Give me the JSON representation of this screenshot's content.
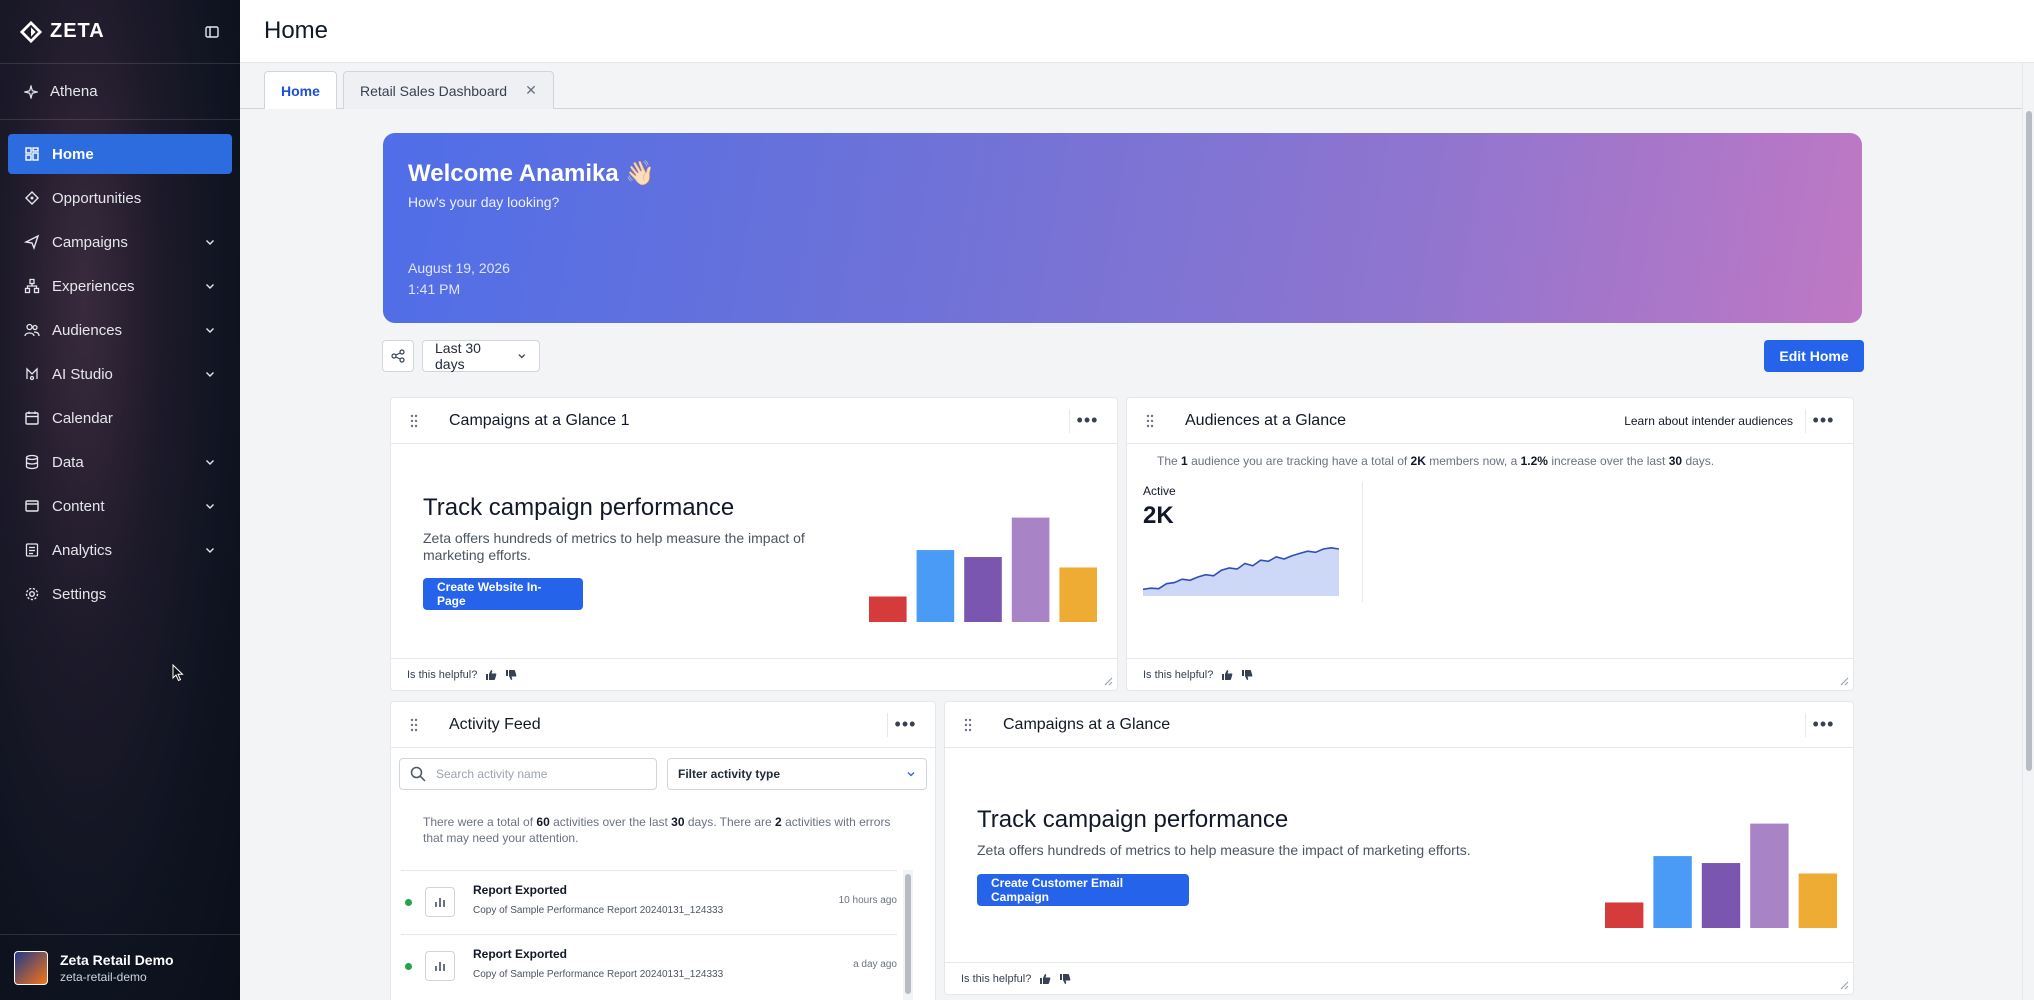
{
  "app": {
    "name": "ZETA"
  },
  "sidebar": {
    "athena_label": "Athena",
    "items": [
      {
        "label": "Home",
        "icon": "grid-icon",
        "active": true,
        "expandable": false
      },
      {
        "label": "Opportunities",
        "icon": "diamond-icon",
        "active": false,
        "expandable": false
      },
      {
        "label": "Campaigns",
        "icon": "send-icon",
        "active": false,
        "expandable": true
      },
      {
        "label": "Experiences",
        "icon": "flow-icon",
        "active": false,
        "expandable": true
      },
      {
        "label": "Audiences",
        "icon": "users-icon",
        "active": false,
        "expandable": true
      },
      {
        "label": "AI Studio",
        "icon": "ai-icon",
        "active": false,
        "expandable": true
      },
      {
        "label": "Calendar",
        "icon": "calendar-icon",
        "active": false,
        "expandable": false
      },
      {
        "label": "Data",
        "icon": "database-icon",
        "active": false,
        "expandable": true
      },
      {
        "label": "Content",
        "icon": "content-icon",
        "active": false,
        "expandable": true
      },
      {
        "label": "Analytics",
        "icon": "analytics-icon",
        "active": false,
        "expandable": true
      },
      {
        "label": "Settings",
        "icon": "gear-icon",
        "active": false,
        "expandable": false
      }
    ],
    "org": {
      "name": "Zeta Retail Demo",
      "id": "zeta-retail-demo"
    }
  },
  "header": {
    "title": "Home"
  },
  "tabs": [
    {
      "label": "Home",
      "active": true,
      "closable": false
    },
    {
      "label": "Retail Sales Dashboard",
      "active": false,
      "closable": true
    }
  ],
  "hero": {
    "title": "Welcome Anamika 👋🏻",
    "subtitle": "How's your day looking?",
    "date": "August 19, 2026",
    "time": "1:41 PM"
  },
  "toolbar": {
    "range": "Last 30 days",
    "edit_label": "Edit Home"
  },
  "cards": {
    "campaigns1": {
      "title": "Campaigns at a Glance 1",
      "promo_title": "Track campaign performance",
      "promo_desc": "Zeta offers hundreds of metrics to help measure the impact of marketing efforts.",
      "button": "Create Website In-Page",
      "helpful": "Is this helpful?"
    },
    "audiences": {
      "title": "Audiences at a Glance",
      "learn_link": "Learn about intender audiences",
      "summary": {
        "prefix": "The",
        "count": "1",
        "mid1": "audience you are tracking have a total of",
        "members": "2K",
        "mid2": "members now, a",
        "pct": "1.2%",
        "mid3": "increase over the last",
        "days": "30",
        "suffix": "days."
      },
      "active_label": "Active",
      "active_value": "2K",
      "helpful": "Is this helpful?"
    },
    "feed": {
      "title": "Activity Feed",
      "search_placeholder": "Search activity name",
      "filter": "Filter activity type",
      "summary": {
        "p1": "There were a total of",
        "total": "60",
        "p2": "activities over the last",
        "days": "30",
        "p3": "days. There are",
        "errors": "2",
        "p4": "activities with errors that may need your attention."
      },
      "items": [
        {
          "name": "Report Exported",
          "desc": "Copy of Sample Performance Report 20240131_124333",
          "time": "10 hours ago"
        },
        {
          "name": "Report Exported",
          "desc": "Copy of Sample Performance Report 20240131_124333",
          "time": "a day ago"
        }
      ]
    },
    "campaigns2": {
      "title": "Campaigns at a Glance",
      "promo_title": "Track campaign performance",
      "promo_desc": "Zeta offers hundreds of metrics to help measure the impact of marketing efforts.",
      "button": "Create Customer Email Campaign",
      "helpful": "Is this helpful?"
    }
  },
  "colors": {
    "accent": "#2563eb",
    "bar_red": "#d63b3b",
    "bar_blue": "#4a9bf5",
    "bar_purple": "#7a56b0",
    "bar_lavender": "#a884c6",
    "bar_orange": "#eeac35",
    "status_ok": "#22a447"
  },
  "illustration_bars": [
    0.22,
    0.62,
    0.56,
    0.9,
    0.47
  ],
  "audience_sparkline": [
    0.12,
    0.14,
    0.13,
    0.22,
    0.24,
    0.3,
    0.28,
    0.34,
    0.38,
    0.36,
    0.46,
    0.5,
    0.48,
    0.58,
    0.54,
    0.64,
    0.62,
    0.7,
    0.66,
    0.72,
    0.76,
    0.8,
    0.78,
    0.84,
    0.86,
    0.84
  ]
}
